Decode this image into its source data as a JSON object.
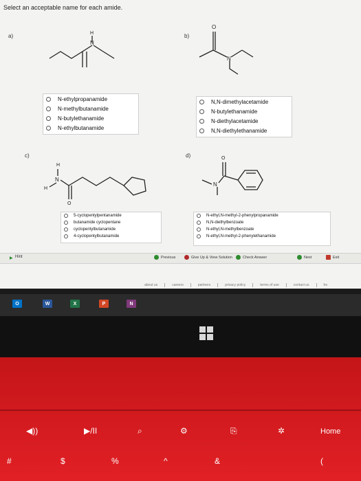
{
  "instruction": "Select an acceptable name for each amide.",
  "labels": {
    "a": "a)",
    "b": "b)",
    "c": "c)",
    "d": "d)"
  },
  "atoms": {
    "H": "H",
    "N": "N",
    "O": "O"
  },
  "options": {
    "a": [
      "N-ethylpropanamide",
      "N-methylbutanamide",
      "N-butylethanamide",
      "N-ethylbutanamide"
    ],
    "b": [
      "N,N-dimethylacetamide",
      "N-butylethanamide",
      "N-diethylacetamide",
      "N,N-diethylethanamide"
    ],
    "c": [
      "5-cyclopentylpentanamide",
      "butanamide cyclopentane",
      "cyclopentylbutanamide",
      "4-cyclopentylbutanamide"
    ],
    "d": [
      "N-ethyl,N-methyl-2-phenylpropanamide",
      "N,N-diethylbenzoate",
      "N-ethyl,N-methylbenzoate",
      "N-ethyl,N-methyl-2-phenylethanamide"
    ]
  },
  "toolbar": {
    "hint": "Hint",
    "previous": "Previous",
    "give_up": "Give Up & View Solution",
    "check": "Check Answer",
    "next": "Next",
    "exit": "Exit"
  },
  "footer": [
    "about us",
    "careers",
    "partners",
    "privacy policy",
    "terms of use",
    "contact us",
    "he"
  ],
  "taskbar": {
    "outlook": "O",
    "word": "W",
    "excel": "X",
    "powerpoint": "P",
    "onenote": "N"
  },
  "keyboard": {
    "home": "Home",
    "row2": [
      "#",
      "$",
      "%",
      "^",
      "&",
      "("
    ],
    "row1": [
      "◀))",
      "▶/II",
      "⌕",
      "⚙",
      "⎘",
      "✲"
    ]
  },
  "colors": {
    "radio": "#555555",
    "keyboard": "#d81c21",
    "outlook": "#0072c6",
    "word": "#2b579a",
    "excel": "#217346",
    "powerpoint": "#d24726",
    "onenote": "#80397b"
  }
}
